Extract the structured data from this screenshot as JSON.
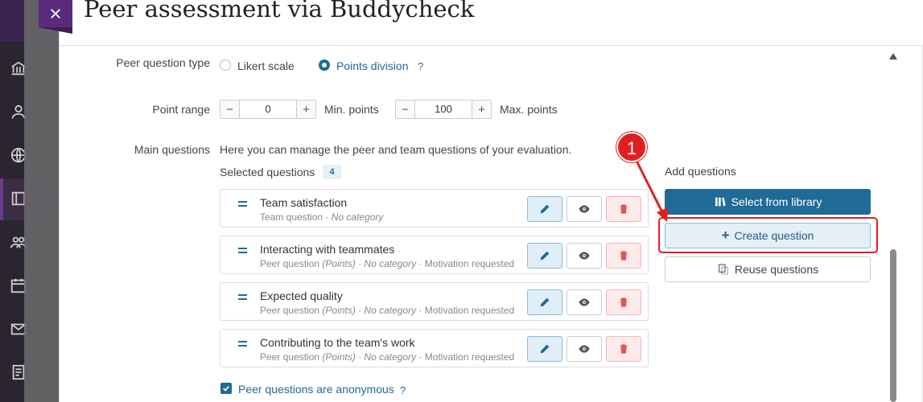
{
  "modal": {
    "title": "Peer assessment via Buddycheck",
    "close_icon": "close-icon"
  },
  "question_type": {
    "label": "Peer question type",
    "options": [
      "Likert scale",
      "Points division"
    ],
    "selected": "Points division",
    "help": "?"
  },
  "point_range": {
    "label": "Point range",
    "min_value": "0",
    "min_label": "Min. points",
    "max_value": "100",
    "max_label": "Max. points"
  },
  "main_questions": {
    "label": "Main questions",
    "description": "Here you can manage the peer and team questions of your evaluation.",
    "selected_label": "Selected questions",
    "selected_count": "4",
    "questions": [
      {
        "title": "Team satisfaction",
        "type": "Team question",
        "points": "",
        "category": "No category",
        "motivation": ""
      },
      {
        "title": "Interacting with teammates",
        "type": "Peer question",
        "points": "(Points)",
        "category": "No category",
        "motivation": "Motivation requested"
      },
      {
        "title": "Expected quality",
        "type": "Peer question",
        "points": "(Points)",
        "category": "No category",
        "motivation": "Motivation requested"
      },
      {
        "title": "Contributing to the team's work",
        "type": "Peer question",
        "points": "(Points)",
        "category": "No category",
        "motivation": "Motivation requested"
      }
    ]
  },
  "add_questions": {
    "label": "Add questions",
    "select_library": "Select from library",
    "create_question": "Create question",
    "reuse_questions": "Reuse questions"
  },
  "anonymous": {
    "label": "Peer questions are anonymous",
    "checked": true,
    "help": "?"
  },
  "annotation": {
    "step": "1",
    "color": "#e02020"
  },
  "colors": {
    "accent": "#1f6b96",
    "danger": "#e05555"
  }
}
